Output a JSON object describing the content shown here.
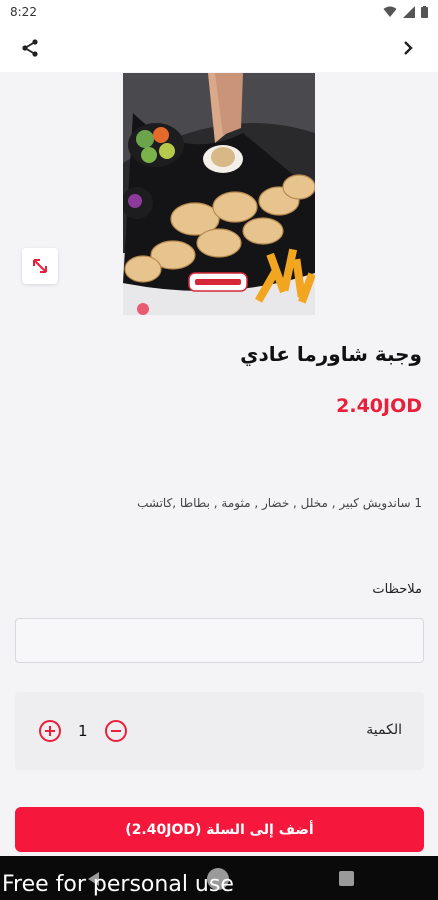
{
  "status_bar": {
    "time": "8:22"
  },
  "app_bar": {
    "share_icon": "share-icon",
    "forward_icon": "chevron-right-icon"
  },
  "product": {
    "title": "وجبة شاورما عادي",
    "price": "2.40JOD",
    "description": "1 ساندويش كبير , مخلل , خضار , مثومة , بطاطا ,كاتشب"
  },
  "notes": {
    "label": "ملاحظات",
    "value": "",
    "placeholder": ""
  },
  "quantity": {
    "label": "الكمية",
    "value": "1"
  },
  "cart_button": {
    "label": "أضف إلى السلة (2.40JOD)"
  },
  "watermark": "Free for personal use",
  "colors": {
    "accent": "#f5173c",
    "price": "#e8203c"
  }
}
